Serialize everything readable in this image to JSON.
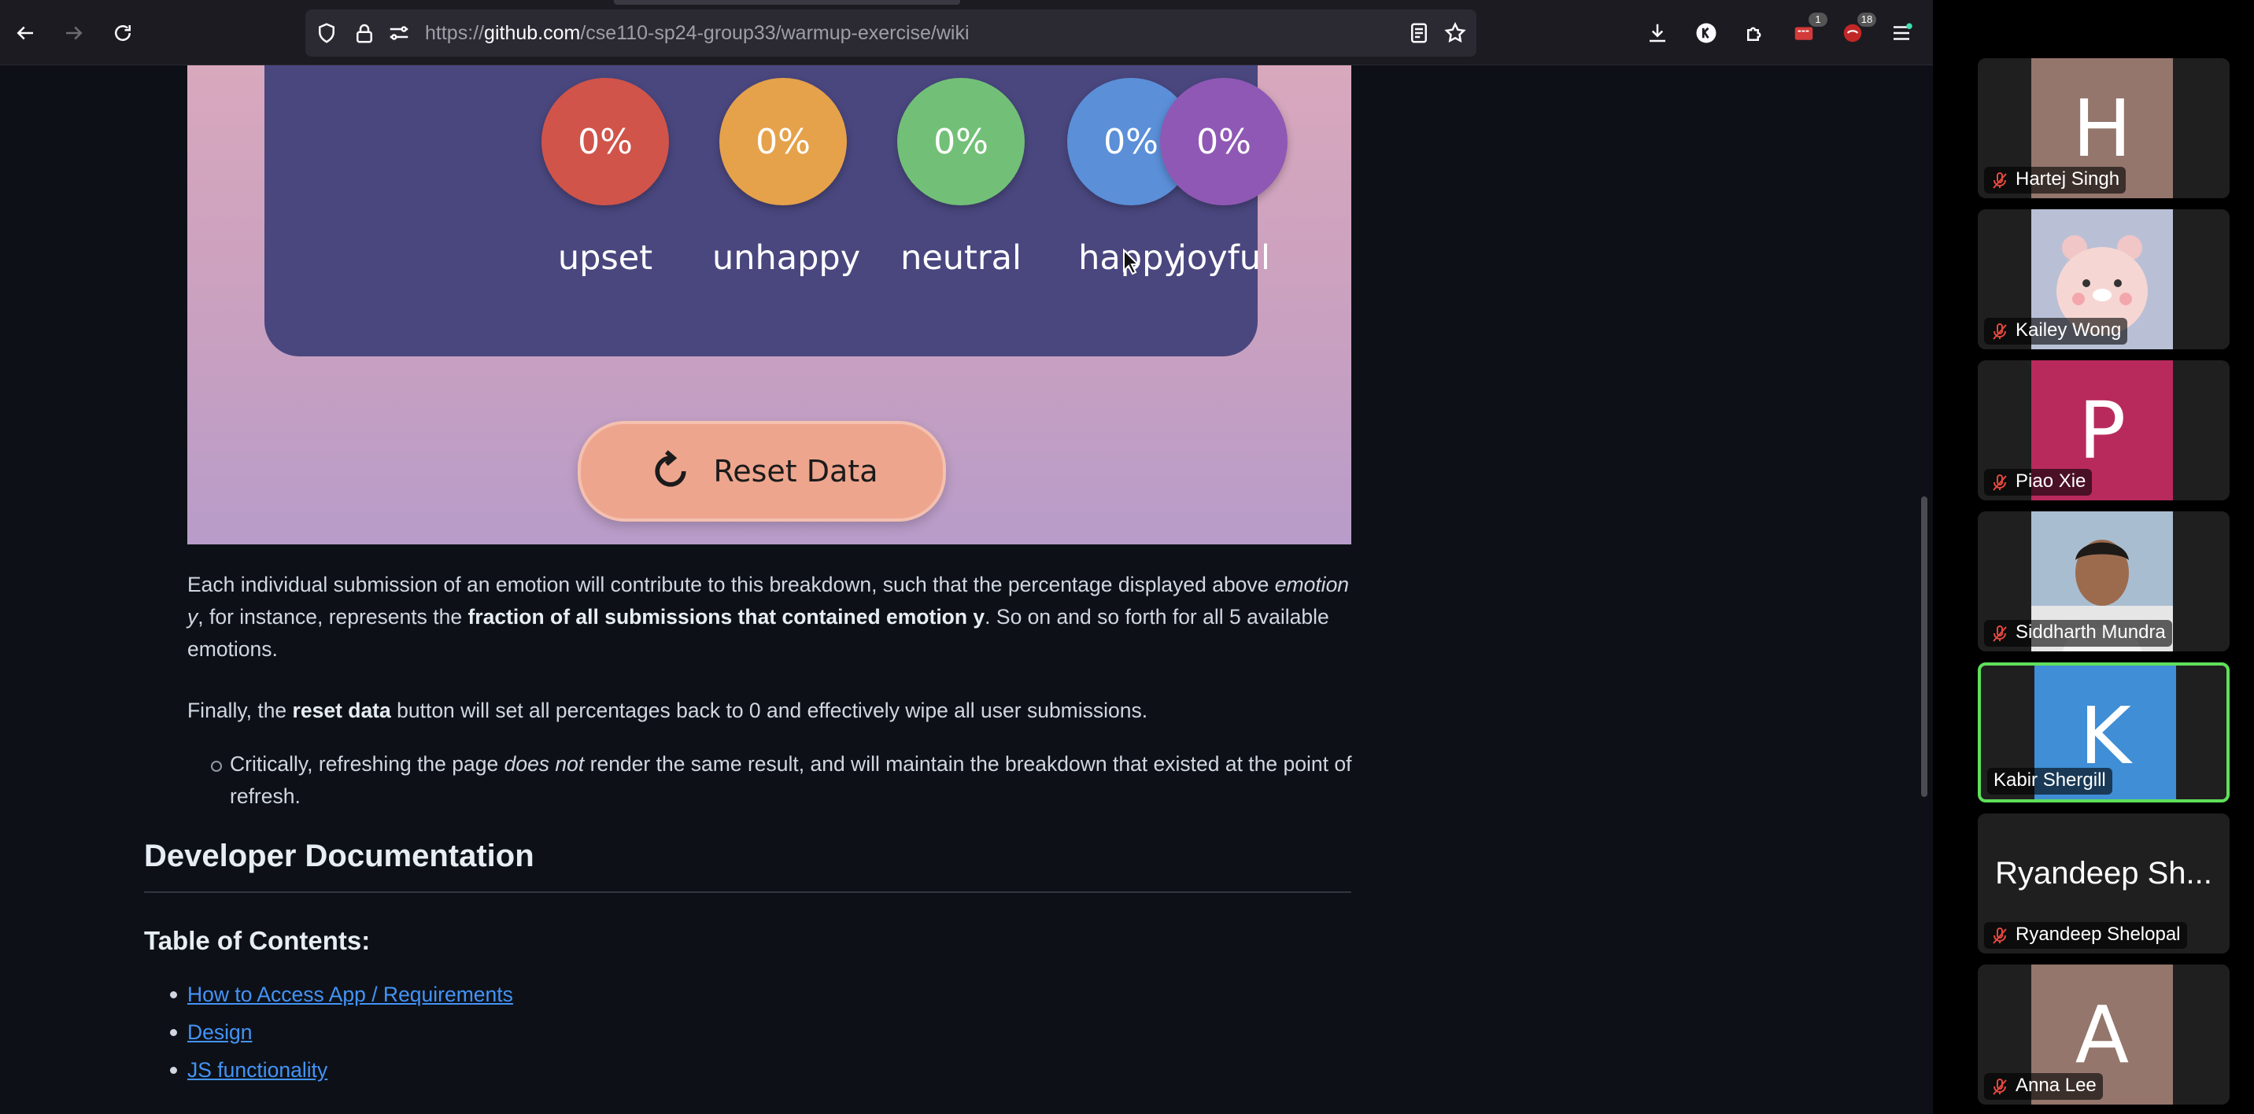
{
  "browser": {
    "url_prefix": "https://",
    "url_domain": "github.com",
    "url_path": "/cse110-sp24-group33/warmup-exercise/wiki",
    "extension_badge_1": "1",
    "extension_badge_2": "18"
  },
  "app": {
    "moods": [
      {
        "percent": "0%",
        "label": "upset",
        "color": "#d0544a"
      },
      {
        "percent": "0%",
        "label": "unhappy",
        "color": "#e5a24b"
      },
      {
        "percent": "0%",
        "label": "neutral",
        "color": "#72c077"
      },
      {
        "percent": "0%",
        "label": "happy",
        "color": "#5b8fd8"
      },
      {
        "percent": "0%",
        "label": "joyful",
        "color": "#8f58b5"
      }
    ],
    "reset_label": "Reset Data"
  },
  "wiki": {
    "para1_a": "Each individual submission of an emotion will contribute to this breakdown, such that the percentage displayed above ",
    "para1_em": "emotion y",
    "para1_b": ", for instance, represents the ",
    "para1_strong": "fraction of all submissions that contained emotion y",
    "para1_c": ". So on and so forth for all 5 available emotions.",
    "para2_a": "Finally, the ",
    "para2_strong": "reset data",
    "para2_b": " button will set all percentages back to 0 and effectively wipe all user submissions.",
    "bullet_a": "Critically, refreshing the page ",
    "bullet_em": "does not",
    "bullet_b": " render the same result, and will maintain the breakdown that existed at the point of refresh.",
    "dev_heading": "Developer Documentation",
    "toc_heading": "Table of Contents:",
    "toc": [
      "How to Access App / Requirements",
      "Design",
      "JS functionality"
    ]
  },
  "participants": [
    {
      "name": "Hartej Singh",
      "initial": "H",
      "bg": "#94766c",
      "muted": true,
      "active": false
    },
    {
      "name": "Kailey Wong",
      "initial": "",
      "bg": "#b9c0d6",
      "muted": true,
      "active": false,
      "picture": "bear-avatar"
    },
    {
      "name": "Piao Xie",
      "initial": "P",
      "bg": "#b92a5c",
      "muted": true,
      "active": false
    },
    {
      "name": "Siddharth Mundra",
      "initial": "",
      "bg": "#8aa3b8",
      "muted": true,
      "active": false,
      "picture": "photo-avatar"
    },
    {
      "name": "Kabir Shergill",
      "initial": "K",
      "bg": "#3f8ed6",
      "muted": false,
      "active": true
    },
    {
      "name": "Ryandeep Shelopal",
      "initial": "",
      "bg": "#1f1f1f",
      "muted": true,
      "active": false,
      "big_name": "Ryandeep Sh..."
    },
    {
      "name": "Anna Lee",
      "initial": "A",
      "bg": "#94766c",
      "muted": true,
      "active": false
    }
  ]
}
